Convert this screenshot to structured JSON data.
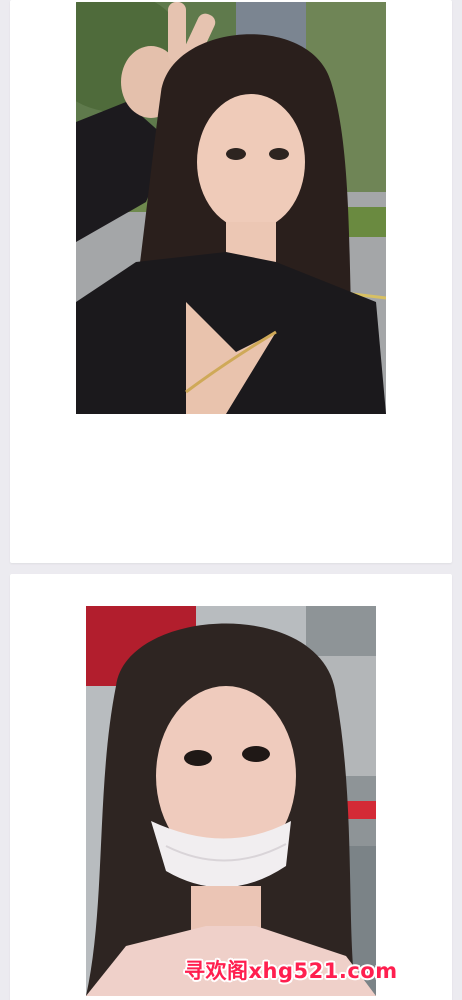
{
  "feed": {
    "posts": [
      {
        "image": {
          "icon": "photo-selfie-peace-sign"
        }
      },
      {
        "image": {
          "icon": "photo-selfie-mask"
        }
      }
    ]
  },
  "watermark": {
    "text": "寻欢阁xhg521.com"
  },
  "colors": {
    "page_background": "#ecebf0",
    "card_background": "#ffffff",
    "watermark_text": "#ff1f4f",
    "watermark_outline": "#ffffff"
  }
}
